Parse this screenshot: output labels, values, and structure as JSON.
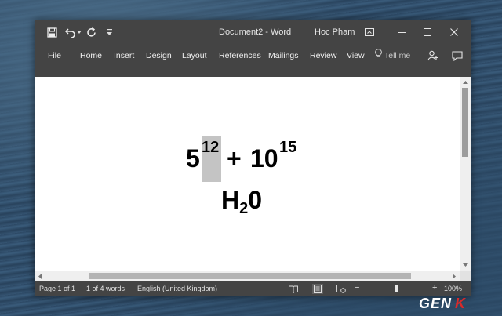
{
  "titlebar": {
    "title": "Document2  -  Word",
    "user": "Hoc Pham",
    "icons": [
      "save-icon",
      "undo-icon",
      "undo-dropdown-icon",
      "redo-icon",
      "customize-qat-icon",
      "ribbon-display-options-icon",
      "minimize-icon",
      "maximize-icon",
      "close-icon"
    ]
  },
  "ribbon": {
    "tabs": [
      "File",
      "Home",
      "Insert",
      "Design",
      "Layout",
      "References",
      "Mailings",
      "Review",
      "View"
    ],
    "tell_me": "Tell me",
    "icons": [
      "lightbulb-icon",
      "share-icon",
      "comments-icon"
    ]
  },
  "document": {
    "eq1_base1": "5",
    "eq1_sup1": "12",
    "eq1_plus": "+",
    "eq1_base2": "10",
    "eq1_sup2": "15",
    "eq2_h": "H",
    "eq2_sub": "2",
    "eq2_o": "0",
    "selection_color": "#c4c4c4"
  },
  "statusbar": {
    "page": "Page 1 of 1",
    "words": "1 of 4 words",
    "language": "English (United Kingdom)",
    "zoom_minus": "−",
    "zoom_plus": "+",
    "zoom_level": "100%",
    "zoom_fraction": 0.5,
    "icons": [
      "read-mode-icon",
      "print-layout-icon",
      "web-layout-icon"
    ]
  },
  "watermark": {
    "text_ge": "GEN",
    "text_k": "K"
  },
  "colors": {
    "chrome": "#444444",
    "page": "#ffffff",
    "scrollbar": "#efefef",
    "logo_accent": "#d92a2a"
  }
}
